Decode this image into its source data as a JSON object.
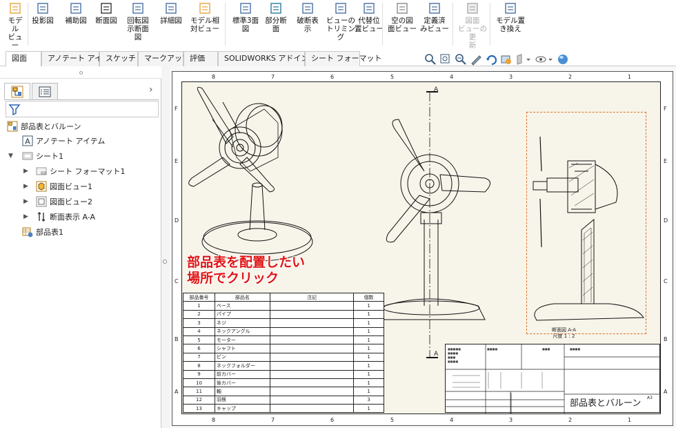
{
  "ribbon": {
    "buttons": [
      {
        "label": "モデル\nビュー",
        "name": "model-view-button",
        "icon": "model-view-icon"
      },
      {
        "label": "投影図",
        "name": "projected-view-button",
        "icon": "projected-view-icon"
      },
      {
        "label": "補助図",
        "name": "auxiliary-view-button",
        "icon": "auxiliary-view-icon"
      },
      {
        "label": "断面図",
        "name": "section-view-button",
        "icon": "section-view-icon"
      },
      {
        "label": "回転図\n示断面\n図",
        "name": "removed-section-button",
        "icon": "removed-section-icon"
      },
      {
        "label": "詳細図",
        "name": "detail-view-button",
        "icon": "detail-view-icon"
      },
      {
        "label": "モデル相\n対ビュー",
        "name": "relative-view-button",
        "icon": "relative-view-icon"
      },
      {
        "label": "標準3面\n図",
        "name": "standard-3-view-button",
        "icon": "standard-3-view-icon"
      },
      {
        "label": "部分断\n面",
        "name": "broken-out-section-button",
        "icon": "broken-out-section-icon"
      },
      {
        "label": "破断表\n示",
        "name": "break-button",
        "icon": "break-icon"
      },
      {
        "label": "ビューの\nトリミング",
        "name": "crop-view-button",
        "icon": "crop-view-icon"
      },
      {
        "label": "代替位\n置ビュー",
        "name": "alternate-position-button",
        "icon": "alternate-position-icon"
      },
      {
        "label": "空の図\n面ビュー",
        "name": "empty-view-button",
        "icon": "empty-view-icon"
      },
      {
        "label": "定義済\nみビュー",
        "name": "predefined-view-button",
        "icon": "predefined-view-icon"
      },
      {
        "label": "図面\nビューの更\n新",
        "name": "update-view-button",
        "icon": "update-view-icon",
        "disabled": true
      },
      {
        "label": "モデル置\nき換え",
        "name": "replace-model-button",
        "icon": "replace-model-icon"
      }
    ]
  },
  "tabs": [
    "図面",
    "アノテート アイテム",
    "スケッチ",
    "マークアップ",
    "評価",
    "SOLIDWORKS アドイン",
    "シート フォーマット"
  ],
  "tree": {
    "root": "部品表とバルーン",
    "items": [
      {
        "label": "アノテート アイテム",
        "icon": "annotation-icon"
      },
      {
        "label": "シート1",
        "icon": "sheet-icon"
      },
      {
        "label": "シート フォーマット1",
        "icon": "sheet-format-icon"
      },
      {
        "label": "図面ビュー1",
        "icon": "drawing-view-icon"
      },
      {
        "label": "図面ビュー2",
        "icon": "drawing-view-icon"
      },
      {
        "label": "断面表示 A-A",
        "icon": "section-icon"
      },
      {
        "label": "部品表1",
        "icon": "bom-icon"
      }
    ]
  },
  "sheet": {
    "zones_top": [
      "8",
      "7",
      "6",
      "5",
      "4",
      "3",
      "2",
      "1"
    ],
    "zones_side": [
      "F",
      "E",
      "D",
      "C",
      "B",
      "A"
    ],
    "section_label": "A",
    "section_caption": "断面図 A-A",
    "section_scale": "尺度 1 : 2",
    "instruction": "部品表を配置したい\n場所でクリック",
    "title_name": "部品表とバルーン",
    "title_size": "A3"
  },
  "bom": {
    "headers": [
      "部品番号",
      "部品名",
      "注記",
      "個数"
    ],
    "rows": [
      [
        "1",
        "ベース",
        "",
        "1"
      ],
      [
        "2",
        "パイプ",
        "",
        "1"
      ],
      [
        "3",
        "ネジ",
        "",
        "1"
      ],
      [
        "4",
        "ネックアングル",
        "",
        "1"
      ],
      [
        "5",
        "モーター",
        "",
        "1"
      ],
      [
        "6",
        "シャフト",
        "",
        "1"
      ],
      [
        "7",
        "ピン",
        "",
        "1"
      ],
      [
        "8",
        "ネックフォルダー",
        "",
        "1"
      ],
      [
        "9",
        "前カバー",
        "",
        "1"
      ],
      [
        "10",
        "後カバー",
        "",
        "1"
      ],
      [
        "11",
        "軸",
        "",
        "1"
      ],
      [
        "12",
        "羽根",
        "",
        "3"
      ],
      [
        "13",
        "キャップ",
        "",
        "1"
      ]
    ]
  }
}
